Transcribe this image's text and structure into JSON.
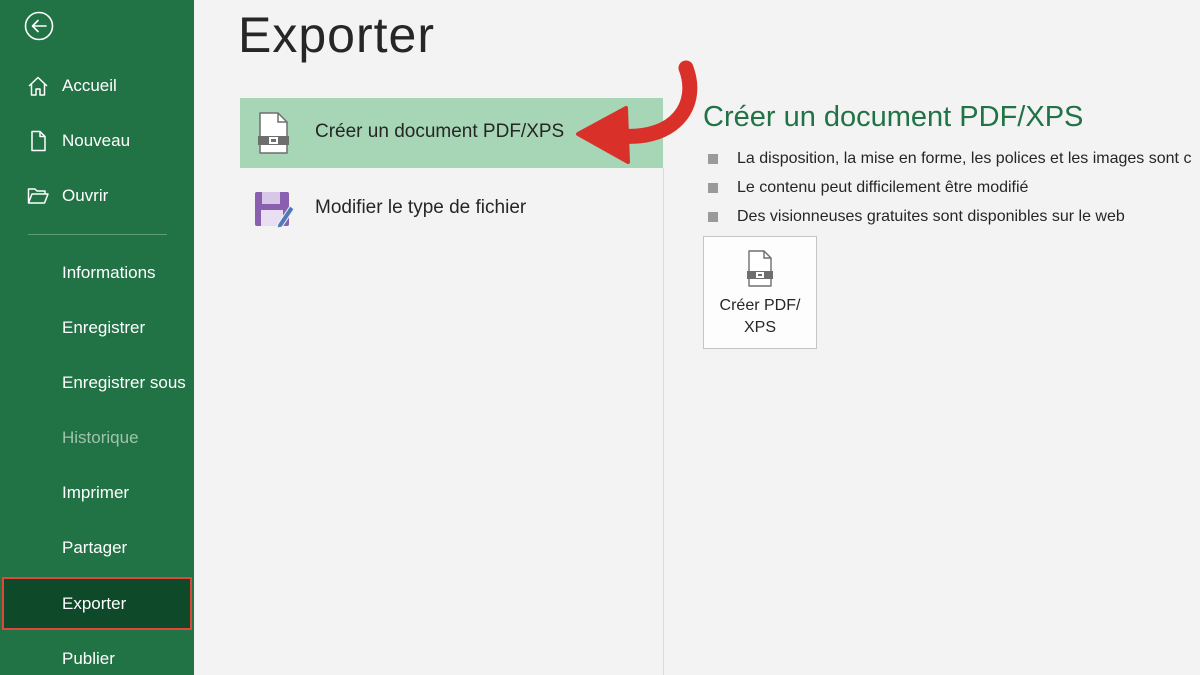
{
  "sidebar": {
    "items": [
      {
        "label": "Accueil",
        "icon": "home-icon"
      },
      {
        "label": "Nouveau",
        "icon": "new-document-icon"
      },
      {
        "label": "Ouvrir",
        "icon": "open-folder-icon"
      },
      {
        "label": "Informations"
      },
      {
        "label": "Enregistrer"
      },
      {
        "label": "Enregistrer sous"
      },
      {
        "label": "Historique",
        "disabled": true
      },
      {
        "label": "Imprimer"
      },
      {
        "label": "Partager"
      },
      {
        "label": "Exporter",
        "selected": true
      },
      {
        "label": "Publier"
      }
    ]
  },
  "main": {
    "title": "Exporter",
    "options": [
      {
        "label": "Créer un document PDF/XPS",
        "icon": "pdf-document-icon",
        "active": true
      },
      {
        "label": "Modifier le type de fichier",
        "icon": "save-as-file-icon"
      }
    ]
  },
  "panel": {
    "title": "Créer un document PDF/XPS",
    "bullets": [
      "La disposition, la mise en forme, les polices et les images sont c",
      "Le contenu peut difficilement être modifié",
      "Des visionneuses gratuites sont disponibles sur le web"
    ],
    "button_label_line1": "Créer PDF/",
    "button_label_line2": "XPS"
  },
  "colors": {
    "sidebar_bg": "#217346",
    "selected_bg": "#0e4a29",
    "highlight_border": "#e0463a",
    "active_option_bg": "#a6d6b5",
    "accent_text": "#217346",
    "arrow": "#d9302a"
  }
}
